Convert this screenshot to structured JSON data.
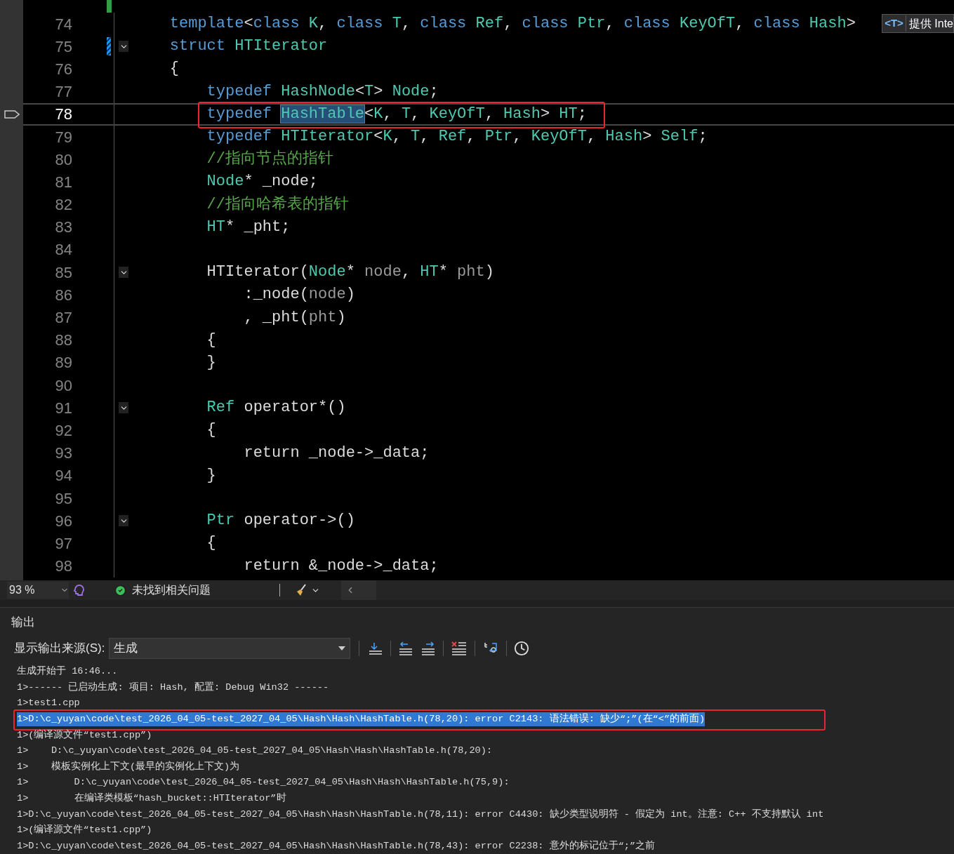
{
  "editor": {
    "lines": [
      {
        "number": "74",
        "current": false,
        "fold": false,
        "changed": false,
        "tokens": [
          {
            "kind": "kw",
            "text": "    template"
          },
          {
            "kind": "plain",
            "text": "<"
          },
          {
            "kind": "kw",
            "text": "class"
          },
          {
            "kind": "type",
            "text": " K"
          },
          {
            "kind": "plain",
            "text": ", "
          },
          {
            "kind": "kw",
            "text": "class"
          },
          {
            "kind": "type",
            "text": " T"
          },
          {
            "kind": "plain",
            "text": ", "
          },
          {
            "kind": "kw",
            "text": "class"
          },
          {
            "kind": "type",
            "text": " Ref"
          },
          {
            "kind": "plain",
            "text": ", "
          },
          {
            "kind": "kw",
            "text": "class"
          },
          {
            "kind": "type",
            "text": " Ptr"
          },
          {
            "kind": "plain",
            "text": ", "
          },
          {
            "kind": "kw",
            "text": "class"
          },
          {
            "kind": "type",
            "text": " KeyOfT"
          },
          {
            "kind": "plain",
            "text": ", "
          },
          {
            "kind": "kw",
            "text": "class"
          },
          {
            "kind": "type",
            "text": " Hash"
          },
          {
            "kind": "plain",
            "text": ">"
          }
        ]
      },
      {
        "number": "75",
        "current": false,
        "fold": true,
        "changed": true,
        "tokens": [
          {
            "kind": "kw",
            "text": "    struct"
          },
          {
            "kind": "type",
            "text": " HTIterator"
          }
        ]
      },
      {
        "number": "76",
        "current": false,
        "fold": false,
        "changed": false,
        "tokens": [
          {
            "kind": "plain",
            "text": "    {"
          }
        ]
      },
      {
        "number": "77",
        "current": false,
        "fold": false,
        "changed": false,
        "tokens": [
          {
            "kind": "kw",
            "text": "        typedef"
          },
          {
            "kind": "type",
            "text": " HashNode"
          },
          {
            "kind": "plain",
            "text": "<"
          },
          {
            "kind": "type",
            "text": "T"
          },
          {
            "kind": "plain",
            "text": ">"
          },
          {
            "kind": "type",
            "text": " Node"
          },
          {
            "kind": "plain",
            "text": ";"
          }
        ]
      },
      {
        "number": "78",
        "current": true,
        "fold": false,
        "changed": false,
        "annotated": true,
        "tokens": [
          {
            "kind": "kw",
            "text": "        typedef "
          },
          {
            "kind": "type",
            "text": "HashTable",
            "selected": true
          },
          {
            "kind": "plain",
            "text": "<"
          },
          {
            "kind": "type",
            "text": "K"
          },
          {
            "kind": "plain",
            "text": ", "
          },
          {
            "kind": "type",
            "text": "T"
          },
          {
            "kind": "plain",
            "text": ", "
          },
          {
            "kind": "type",
            "text": "KeyOfT"
          },
          {
            "kind": "plain",
            "text": ", "
          },
          {
            "kind": "type",
            "text": "Hash"
          },
          {
            "kind": "plain",
            "text": "> "
          },
          {
            "kind": "type",
            "text": "HT"
          },
          {
            "kind": "plain",
            "text": ";"
          }
        ]
      },
      {
        "number": "79",
        "current": false,
        "fold": false,
        "changed": false,
        "tokens": [
          {
            "kind": "kw",
            "text": "        typedef"
          },
          {
            "kind": "type",
            "text": " HTIterator"
          },
          {
            "kind": "plain",
            "text": "<"
          },
          {
            "kind": "type",
            "text": "K"
          },
          {
            "kind": "plain",
            "text": ", "
          },
          {
            "kind": "type",
            "text": "T"
          },
          {
            "kind": "plain",
            "text": ", "
          },
          {
            "kind": "type",
            "text": "Ref"
          },
          {
            "kind": "plain",
            "text": ", "
          },
          {
            "kind": "type",
            "text": "Ptr"
          },
          {
            "kind": "plain",
            "text": ", "
          },
          {
            "kind": "type",
            "text": "KeyOfT"
          },
          {
            "kind": "plain",
            "text": ", "
          },
          {
            "kind": "type",
            "text": "Hash"
          },
          {
            "kind": "plain",
            "text": "> "
          },
          {
            "kind": "type",
            "text": "Self"
          },
          {
            "kind": "plain",
            "text": ";"
          }
        ]
      },
      {
        "number": "80",
        "current": false,
        "fold": false,
        "changed": false,
        "tokens": [
          {
            "kind": "cmt",
            "text": "        //指向节点的指针"
          }
        ]
      },
      {
        "number": "81",
        "current": false,
        "fold": false,
        "changed": false,
        "tokens": [
          {
            "kind": "type",
            "text": "        Node"
          },
          {
            "kind": "plain",
            "text": "* _node;"
          }
        ]
      },
      {
        "number": "82",
        "current": false,
        "fold": false,
        "changed": false,
        "tokens": [
          {
            "kind": "cmt",
            "text": "        //指向哈希表的指针"
          }
        ]
      },
      {
        "number": "83",
        "current": false,
        "fold": false,
        "changed": false,
        "tokens": [
          {
            "kind": "type",
            "text": "        HT"
          },
          {
            "kind": "plain",
            "text": "* _pht;"
          }
        ]
      },
      {
        "number": "84",
        "current": false,
        "fold": false,
        "changed": false
      },
      {
        "number": "85",
        "current": false,
        "fold": true,
        "changed": false,
        "tokens": [
          {
            "kind": "plain",
            "text": "        HTIterator("
          },
          {
            "kind": "type",
            "text": "Node"
          },
          {
            "kind": "plain",
            "text": "* "
          },
          {
            "kind": "param",
            "text": "node"
          },
          {
            "kind": "plain",
            "text": ", "
          },
          {
            "kind": "type",
            "text": "HT"
          },
          {
            "kind": "plain",
            "text": "* "
          },
          {
            "kind": "param",
            "text": "pht"
          },
          {
            "kind": "plain",
            "text": ")"
          }
        ]
      },
      {
        "number": "86",
        "current": false,
        "fold": false,
        "changed": false,
        "tokens": [
          {
            "kind": "plain",
            "text": "            :_node("
          },
          {
            "kind": "param",
            "text": "node"
          },
          {
            "kind": "plain",
            "text": ")"
          }
        ]
      },
      {
        "number": "87",
        "current": false,
        "fold": false,
        "changed": false,
        "tokens": [
          {
            "kind": "plain",
            "text": "            , _pht("
          },
          {
            "kind": "param",
            "text": "pht"
          },
          {
            "kind": "plain",
            "text": ")"
          }
        ]
      },
      {
        "number": "88",
        "current": false,
        "fold": false,
        "changed": false,
        "tokens": [
          {
            "kind": "plain",
            "text": "        {"
          }
        ]
      },
      {
        "number": "89",
        "current": false,
        "fold": false,
        "changed": false,
        "tokens": [
          {
            "kind": "plain",
            "text": "        }"
          }
        ]
      },
      {
        "number": "90",
        "current": false,
        "fold": false,
        "changed": false
      },
      {
        "number": "91",
        "current": false,
        "fold": true,
        "changed": false,
        "tokens": [
          {
            "kind": "type",
            "text": "        Ref"
          },
          {
            "kind": "plain",
            "text": " operator*()"
          }
        ]
      },
      {
        "number": "92",
        "current": false,
        "fold": false,
        "changed": false,
        "tokens": [
          {
            "kind": "plain",
            "text": "        {"
          }
        ]
      },
      {
        "number": "93",
        "current": false,
        "fold": false,
        "changed": false,
        "tokens": [
          {
            "kind": "plain",
            "text": "            return _node->_data;"
          }
        ]
      },
      {
        "number": "94",
        "current": false,
        "fold": false,
        "changed": false,
        "tokens": [
          {
            "kind": "plain",
            "text": "        }"
          }
        ]
      },
      {
        "number": "95",
        "current": false,
        "fold": false,
        "changed": false
      },
      {
        "number": "96",
        "current": false,
        "fold": true,
        "changed": false,
        "tokens": [
          {
            "kind": "type",
            "text": "        Ptr"
          },
          {
            "kind": "plain",
            "text": " operator->()"
          }
        ]
      },
      {
        "number": "97",
        "current": false,
        "fold": false,
        "changed": false,
        "tokens": [
          {
            "kind": "plain",
            "text": "        {"
          }
        ]
      },
      {
        "number": "98",
        "current": false,
        "fold": false,
        "changed": false,
        "tokens": [
          {
            "kind": "plain",
            "text": "            return &_node->_data;"
          }
        ]
      }
    ],
    "tooltip": {
      "badge": "<T>",
      "text": "提供 Inte"
    }
  },
  "status_bar": {
    "zoom": "93 %",
    "issues": "未找到相关问题"
  },
  "output": {
    "title": "输出",
    "source_label": "显示输出来源(S):",
    "source_value": "生成",
    "lines": [
      {
        "text": "生成开始于 16:46...",
        "selected": false
      },
      {
        "text": "1>------ 已启动生成: 项目: Hash, 配置: Debug Win32 ------",
        "selected": false
      },
      {
        "text": "1>test1.cpp",
        "selected": false
      },
      {
        "text": "1>D:\\c_yuyan\\code\\test_2026_04_05-test_2027_04_05\\Hash\\Hash\\HashTable.h(78,20): error C2143: 语法错误: 缺少“;”(在“<”的前面)",
        "selected": true,
        "annotated": true
      },
      {
        "text": "1>(编译源文件“test1.cpp”)",
        "selected": false
      },
      {
        "text": "1>    D:\\c_yuyan\\code\\test_2026_04_05-test_2027_04_05\\Hash\\Hash\\HashTable.h(78,20):",
        "selected": false
      },
      {
        "text": "1>    模板实例化上下文(最早的实例化上下文)为",
        "selected": false
      },
      {
        "text": "1>        D:\\c_yuyan\\code\\test_2026_04_05-test_2027_04_05\\Hash\\Hash\\HashTable.h(75,9):",
        "selected": false
      },
      {
        "text": "1>        在编译类模板“hash_bucket::HTIterator”时",
        "selected": false
      },
      {
        "text": "1>D:\\c_yuyan\\code\\test_2026_04_05-test_2027_04_05\\Hash\\Hash\\HashTable.h(78,11): error C4430: 缺少类型说明符 - 假定为 int。注意: C++ 不支持默认 int",
        "selected": false
      },
      {
        "text": "1>(编译源文件“test1.cpp”)",
        "selected": false
      },
      {
        "text": "1>D:\\c_yuyan\\code\\test_2026_04_05-test_2027_04_05\\Hash\\Hash\\HashTable.h(78,43): error C2238: 意外的标记位于“;”之前",
        "selected": false
      }
    ]
  }
}
